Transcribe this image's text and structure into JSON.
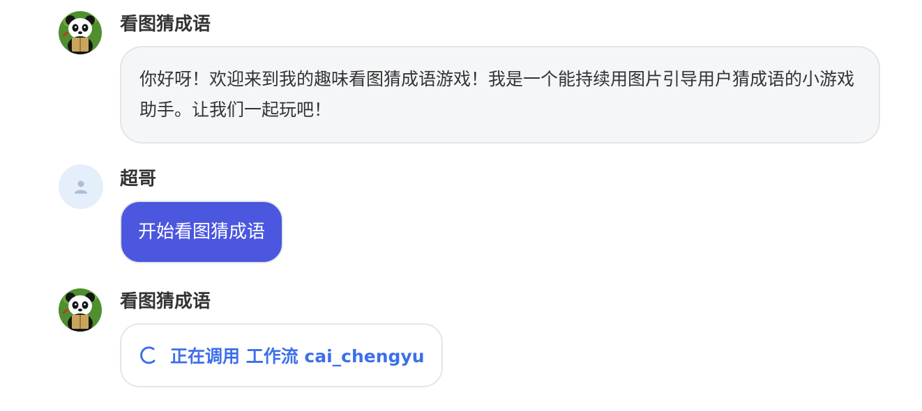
{
  "messages": [
    {
      "sender": "看图猜成语",
      "avatar_icon": "panda-avatar-icon",
      "text": "你好呀！欢迎来到我的趣味看图猜成语游戏！我是一个能持续用图片引导用户猜成语的小游戏助手。让我们一起玩吧！"
    },
    {
      "sender": "超哥",
      "avatar_icon": "user-avatar-icon",
      "text": "开始看图猜成语"
    },
    {
      "sender": "看图猜成语",
      "avatar_icon": "panda-avatar-icon",
      "status_icon": "loading-spinner-icon",
      "status_text": "正在调用 工作流 cai_chengyu"
    }
  ],
  "colors": {
    "user_bubble": "#4b57df",
    "status_text": "#3d6fea",
    "bot_bubble": "#f5f6f8",
    "avatar_bg": "#e5eefb"
  }
}
